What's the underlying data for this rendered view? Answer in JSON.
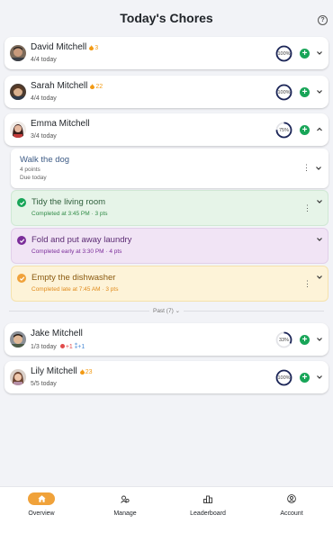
{
  "header": {
    "title": "Today's Chores",
    "help_icon": "?"
  },
  "people": [
    {
      "name": "David Mitchell",
      "streak": "3",
      "sub": "4/4 today",
      "progress": "100%",
      "progress_value": 1.0,
      "avatar_icon": "avatar-david"
    },
    {
      "name": "Sarah Mitchell",
      "streak": "22",
      "sub": "4/4 today",
      "progress": "100%",
      "progress_value": 1.0,
      "avatar_icon": "avatar-sarah"
    },
    {
      "name": "Emma Mitchell",
      "streak": "",
      "sub": "3/4 today",
      "progress": "75%",
      "progress_value": 0.75,
      "avatar_icon": "avatar-emma"
    },
    {
      "name": "Jake Mitchell",
      "streak": "",
      "sub": "1/3 today",
      "progress": "33%",
      "progress_value": 0.33,
      "badge_neg": "+1",
      "badge_pos": "+1",
      "avatar_icon": "avatar-jake"
    },
    {
      "name": "Lily Mitchell",
      "streak": "23",
      "sub": "5/5 today",
      "progress": "100%",
      "progress_value": 1.0,
      "avatar_icon": "avatar-lily"
    }
  ],
  "chores": [
    {
      "name": "Walk the dog",
      "line1": "4 points",
      "line2": "Due today",
      "status": "pending"
    },
    {
      "name": "Tidy the living room",
      "line1": "Completed at 3:45 PM · 3 pts",
      "status": "completed"
    },
    {
      "name": "Fold and put away laundry",
      "line1": "Completed early at 3:30 PM · 4 pts",
      "status": "early"
    },
    {
      "name": "Empty the dishwasher",
      "line1": "Completed late at 7:45 AM · 3 pts",
      "status": "late"
    }
  ],
  "past": {
    "label": "Past (7)"
  },
  "nav": [
    {
      "label": "Overview",
      "icon": "home-icon",
      "active": true
    },
    {
      "label": "Manage",
      "icon": "manage-icon"
    },
    {
      "label": "Leaderboard",
      "icon": "leaderboard-icon"
    },
    {
      "label": "Account",
      "icon": "account-icon"
    }
  ],
  "colors": {
    "accent": "#f0a23a",
    "add_green": "#18a558",
    "ring_navy": "#1b2557",
    "completed_bg": "#e6f4e8",
    "early_bg": "#f1e4f5",
    "late_bg": "#fdf3d8"
  }
}
